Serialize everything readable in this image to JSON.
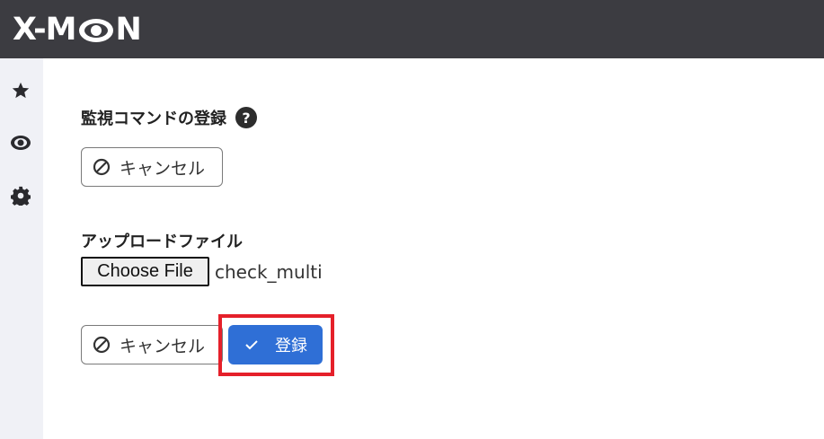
{
  "header": {
    "logo_text_left": "X-M",
    "logo_text_right": "N"
  },
  "sidebar": {
    "items": [
      {
        "icon": "star-icon"
      },
      {
        "icon": "eye-icon"
      },
      {
        "icon": "gear-icon"
      }
    ]
  },
  "main": {
    "title": "監視コマンドの登録",
    "help_glyph": "?",
    "top_cancel_label": "キャンセル",
    "upload_label": "アップロードファイル",
    "choose_file_label": "Choose File",
    "file_name": "check_multi",
    "bottom_cancel_label": "キャンセル",
    "submit_label": "登録"
  },
  "colors": {
    "header_bg": "#3c3c41",
    "sidebar_bg": "#f0f1f6",
    "primary": "#2f6fd6",
    "highlight": "#e5202a"
  }
}
